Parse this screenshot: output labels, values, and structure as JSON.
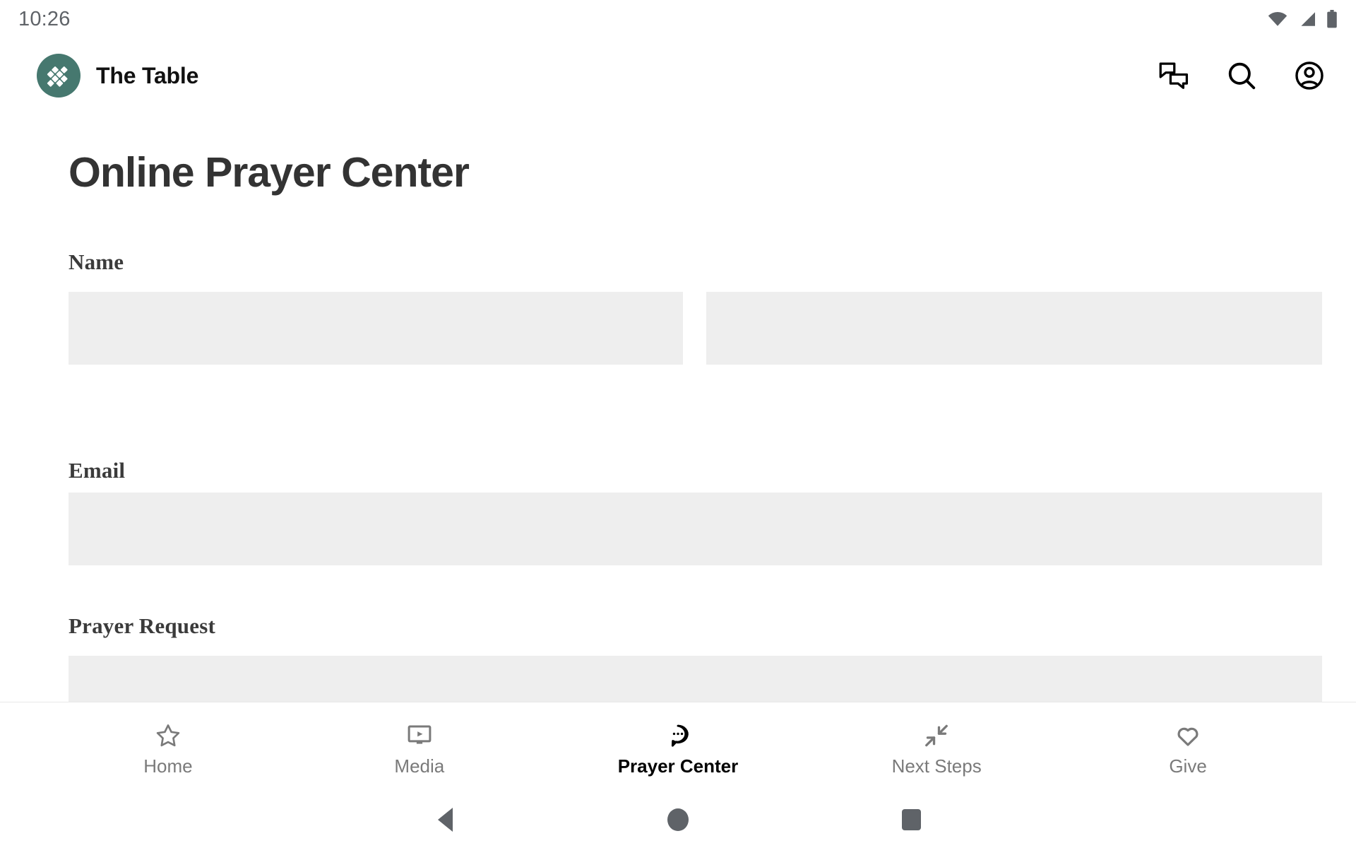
{
  "status_bar": {
    "clock": "10:26",
    "icons": [
      {
        "name": "wifi-icon",
        "glyph": "wifi"
      },
      {
        "name": "cellular-signal-icon",
        "glyph": "signal"
      },
      {
        "name": "battery-icon",
        "glyph": "battery"
      }
    ]
  },
  "app_bar": {
    "brand_name": "The Table",
    "logo_name": "the-table-logo",
    "logo_color": "#46786f",
    "actions": [
      {
        "name": "messages-icon",
        "label": "Messages"
      },
      {
        "name": "search-icon",
        "label": "Search"
      },
      {
        "name": "account-icon",
        "label": "Account"
      }
    ]
  },
  "page": {
    "title": "Online Prayer Center"
  },
  "form": {
    "fields": [
      {
        "label": "Name",
        "inputs": [
          {
            "name": "first-name-input",
            "value": "",
            "placeholder": ""
          },
          {
            "name": "last-name-input",
            "value": "",
            "placeholder": ""
          }
        ]
      },
      {
        "label": "Email",
        "inputs": [
          {
            "name": "email-input",
            "value": "",
            "placeholder": ""
          }
        ]
      },
      {
        "label": "Prayer Request",
        "inputs": [
          {
            "name": "prayer-request-textarea",
            "value": "",
            "placeholder": ""
          }
        ]
      }
    ],
    "field_background": "#eeeeee"
  },
  "tab_bar": {
    "active": "Prayer Center",
    "tabs": [
      {
        "label": "Home",
        "icon": "star-icon",
        "active": false
      },
      {
        "label": "Media",
        "icon": "tv-play-icon",
        "active": false
      },
      {
        "label": "Prayer Center",
        "icon": "chat-bubble-dots-icon",
        "active": true
      },
      {
        "label": "Next Steps",
        "icon": "collapse-arrows-icon",
        "active": false
      },
      {
        "label": "Give",
        "icon": "heart-icon",
        "active": false
      }
    ],
    "inactive_color": "#7a7a7a",
    "active_color": "#000000"
  },
  "system_nav": {
    "buttons": [
      {
        "name": "back-button",
        "icon": "triangle-back-icon"
      },
      {
        "name": "home-button",
        "icon": "circle-home-icon"
      },
      {
        "name": "recents-button",
        "icon": "square-recents-icon"
      }
    ],
    "color": "#5f6368"
  }
}
